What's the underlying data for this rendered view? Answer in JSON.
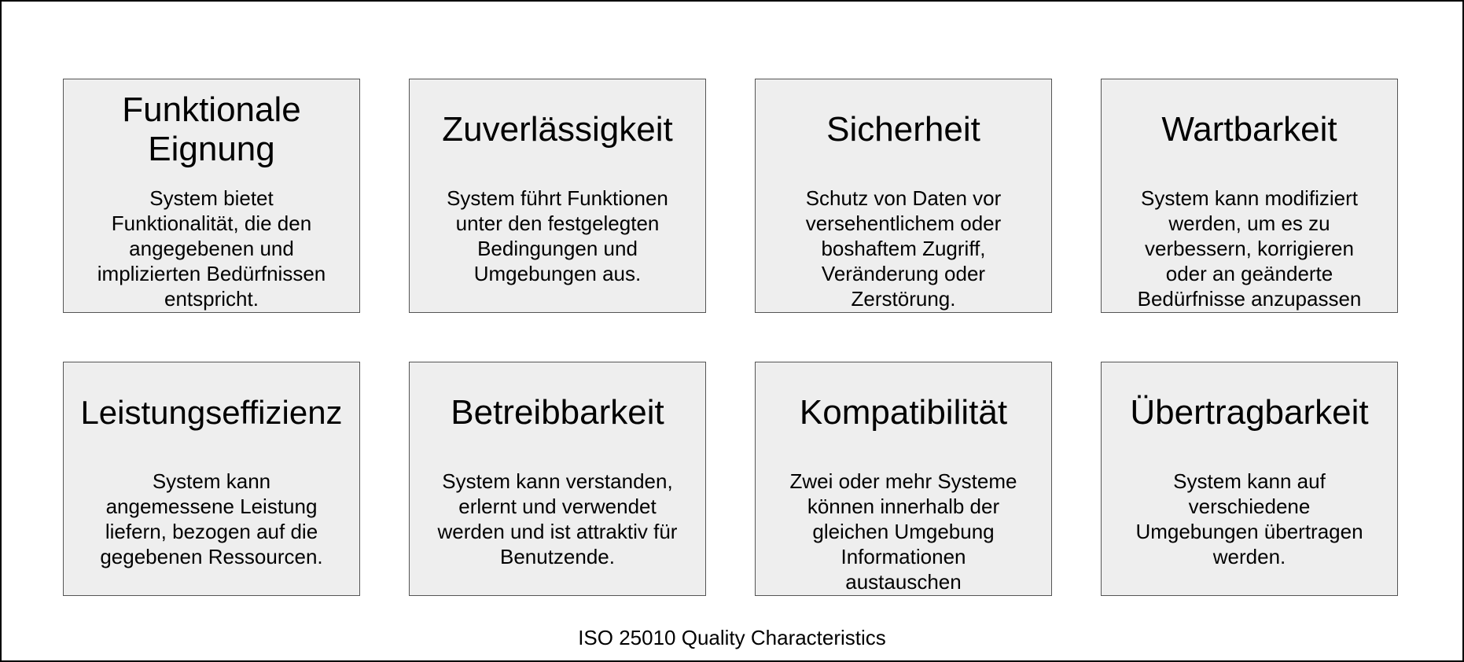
{
  "diagram": {
    "caption": "ISO 25010 Quality Characteristics",
    "cards": [
      {
        "title": "Funktionale\nEignung",
        "description": "System bietet\nFunktionalität, die den\nangegebenen und\nimplizierten  Bedürfnissen\nentspricht."
      },
      {
        "title": "Zuverlässigkeit",
        "description": "System führt Funktionen\nunter den festgelegten\nBedingungen und\nUmgebungen aus."
      },
      {
        "title": "Sicherheit",
        "description": "Schutz von Daten vor\nversehentlichem oder\nboshaftem Zugriff,\nVeränderung oder\nZerstörung."
      },
      {
        "title": "Wartbarkeit",
        "description": "System kann modifiziert\nwerden, um es zu\nverbessern, korrigieren\noder an geänderte\nBedürfnisse anzupassen"
      },
      {
        "title": "Leistungseffizienz",
        "description": "System kann\nangemessene Leistung\nliefern, bezogen auf die\ngegebenen Ressourcen."
      },
      {
        "title": "Betreibbarkeit",
        "description": "System kann verstanden,\nerlernt und verwendet\nwerden und ist attraktiv für\nBenutzende."
      },
      {
        "title": "Kompatibilität",
        "description": "Zwei oder mehr Systeme\nkönnen innerhalb der\ngleichen Umgebung\nInformationen\naustauschen"
      },
      {
        "title": "Übertragbarkeit",
        "description": "System kann auf\nverschiedene\nUmgebungen übertragen\nwerden."
      }
    ]
  }
}
